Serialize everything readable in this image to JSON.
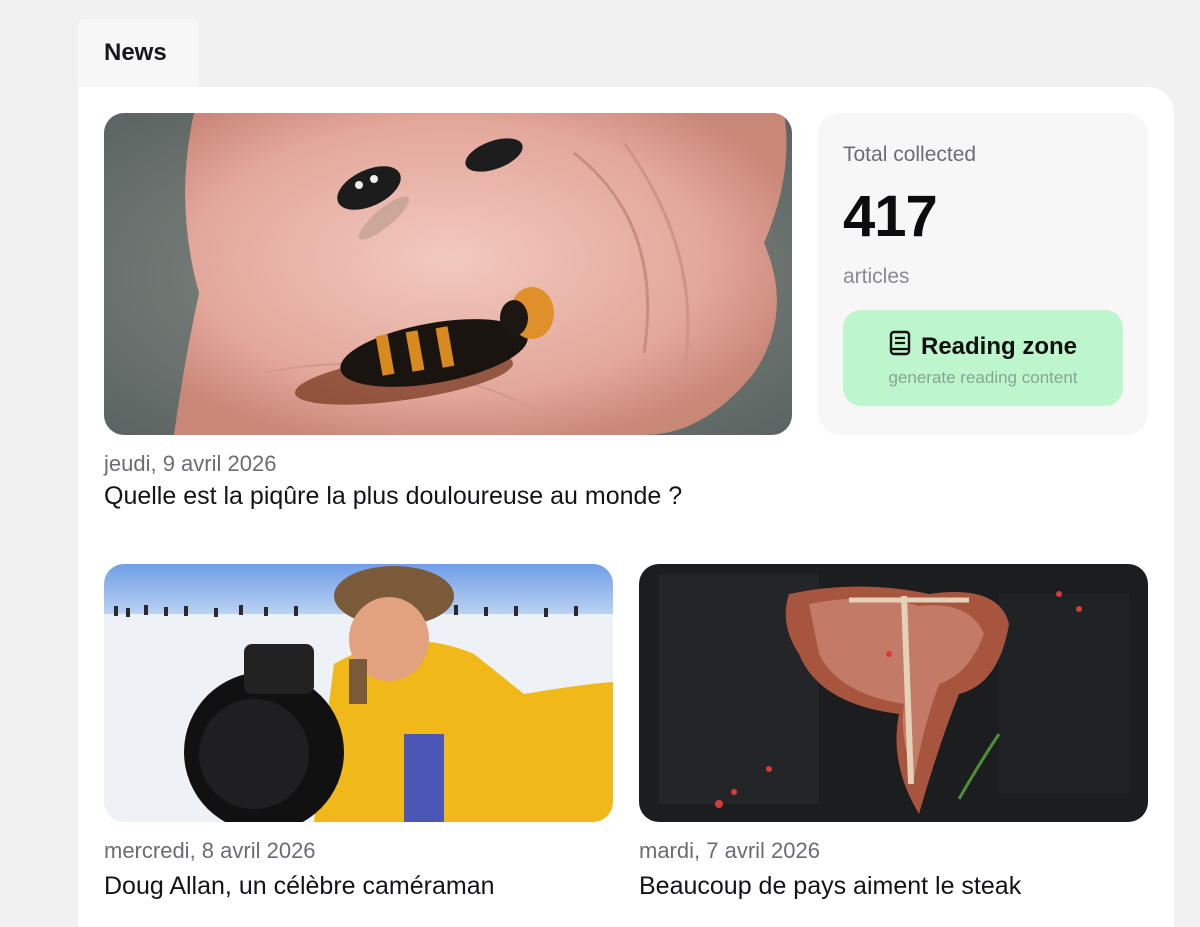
{
  "tab": {
    "label": "News"
  },
  "stats": {
    "label": "Total collected",
    "count": "417",
    "unit": "articles",
    "reading_button": {
      "label": "Reading zone",
      "sublabel": "generate reading content",
      "icon": "book-icon"
    }
  },
  "articles": [
    {
      "date": "jeudi, 9 avril 2026",
      "title": "Quelle est la piqûre la plus douloureuse au monde ?",
      "image": "wasps-in-hand-photo"
    },
    {
      "date": "mercredi, 8 avril 2026",
      "title": "Doug Allan, un célèbre caméraman",
      "image": "cameraman-with-penguins-photo"
    },
    {
      "date": "mardi, 7 avril 2026",
      "title": "Beaucoup de pays aiment le steak",
      "image": "t-bone-steak-photo"
    }
  ],
  "colors": {
    "background": "#f1f1f2",
    "panel": "#ffffff",
    "reading_button": "#bdf5cd"
  }
}
